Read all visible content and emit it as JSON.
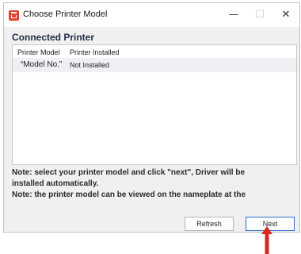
{
  "window": {
    "title": "Choose Printer Model",
    "minimize_glyph": "—",
    "maximize_glyph": "☐",
    "close_glyph": "✕",
    "app_icon": "printer-app-icon"
  },
  "main": {
    "section_label": "Connected Printer",
    "columns": [
      "Printer Model",
      "Printer Installed"
    ],
    "rows": [
      {
        "model": "“Model No.”",
        "status": "Not Installed"
      }
    ],
    "notes": [
      "Note: select your printer model and click \"next\", Driver will be",
      "installed automatically.",
      "Note: the printer model can be viewed on the nameplate at the"
    ]
  },
  "buttons": {
    "refresh": "Refresh",
    "next": "Next"
  },
  "colors": {
    "accent": "#2f6fd1",
    "annotation_arrow": "#d8271f"
  }
}
